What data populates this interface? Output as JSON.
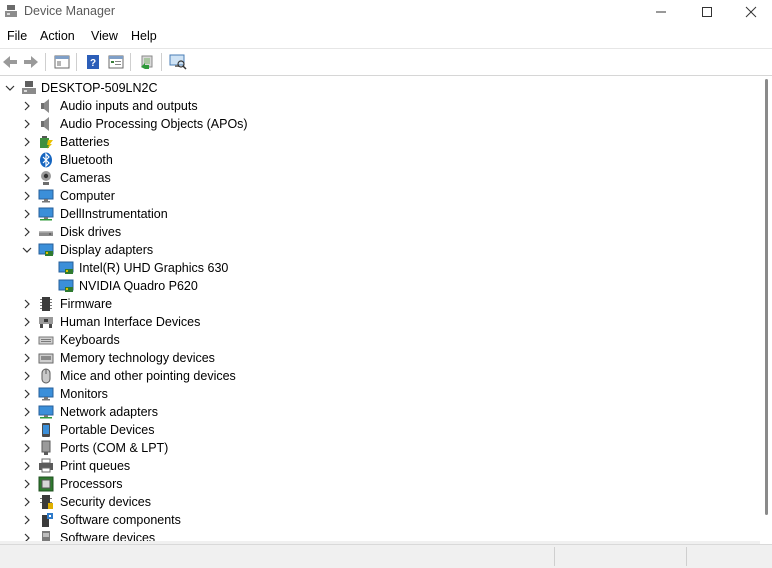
{
  "window": {
    "title": "Device Manager",
    "icon": "device-manager-icon",
    "controls": [
      "minimize-icon",
      "maximize-icon",
      "close-icon"
    ]
  },
  "menu": {
    "file": "File",
    "action": "Action",
    "view": "View",
    "help": "Help"
  },
  "toolbar": {
    "buttons": [
      "back-arrow-icon",
      "forward-arrow-icon",
      "show-hide-console-tree-icon",
      "help-icon",
      "properties-icon",
      "update-driver-icon",
      "scan-hardware-icon"
    ]
  },
  "tree": {
    "root": "DESKTOP-509LN2C",
    "items": [
      {
        "label": "Audio inputs and outputs",
        "icon": "speaker-icon",
        "expanded": false
      },
      {
        "label": "Audio Processing Objects (APOs)",
        "icon": "speaker-icon",
        "expanded": false
      },
      {
        "label": "Batteries",
        "icon": "battery-icon",
        "expanded": false
      },
      {
        "label": "Bluetooth",
        "icon": "bluetooth-icon",
        "expanded": false
      },
      {
        "label": "Cameras",
        "icon": "camera-icon",
        "expanded": false
      },
      {
        "label": "Computer",
        "icon": "computer-icon",
        "expanded": false
      },
      {
        "label": "DellInstrumentation",
        "icon": "monitor-network-icon",
        "expanded": false
      },
      {
        "label": "Disk drives",
        "icon": "disk-drive-icon",
        "expanded": false
      },
      {
        "label": "Display adapters",
        "icon": "display-adapter-icon",
        "expanded": true,
        "children": [
          "Intel(R) UHD Graphics 630",
          "NVIDIA Quadro P620"
        ]
      },
      {
        "label": "Firmware",
        "icon": "chip-icon",
        "expanded": false
      },
      {
        "label": "Human Interface Devices",
        "icon": "hid-icon",
        "expanded": false
      },
      {
        "label": "Keyboards",
        "icon": "keyboard-icon",
        "expanded": false
      },
      {
        "label": "Memory technology devices",
        "icon": "memory-icon",
        "expanded": false
      },
      {
        "label": "Mice and other pointing devices",
        "icon": "mouse-icon",
        "expanded": false
      },
      {
        "label": "Monitors",
        "icon": "monitor-icon",
        "expanded": false
      },
      {
        "label": "Network adapters",
        "icon": "network-adapter-icon",
        "expanded": false
      },
      {
        "label": "Portable Devices",
        "icon": "portable-device-icon",
        "expanded": false
      },
      {
        "label": "Ports (COM & LPT)",
        "icon": "port-icon",
        "expanded": false
      },
      {
        "label": "Print queues",
        "icon": "printer-icon",
        "expanded": false
      },
      {
        "label": "Processors",
        "icon": "processor-icon",
        "expanded": false
      },
      {
        "label": "Security devices",
        "icon": "security-device-icon",
        "expanded": false
      },
      {
        "label": "Software components",
        "icon": "software-component-icon",
        "expanded": false
      },
      {
        "label": "Software devices",
        "icon": "software-device-icon",
        "expanded": false
      }
    ]
  }
}
